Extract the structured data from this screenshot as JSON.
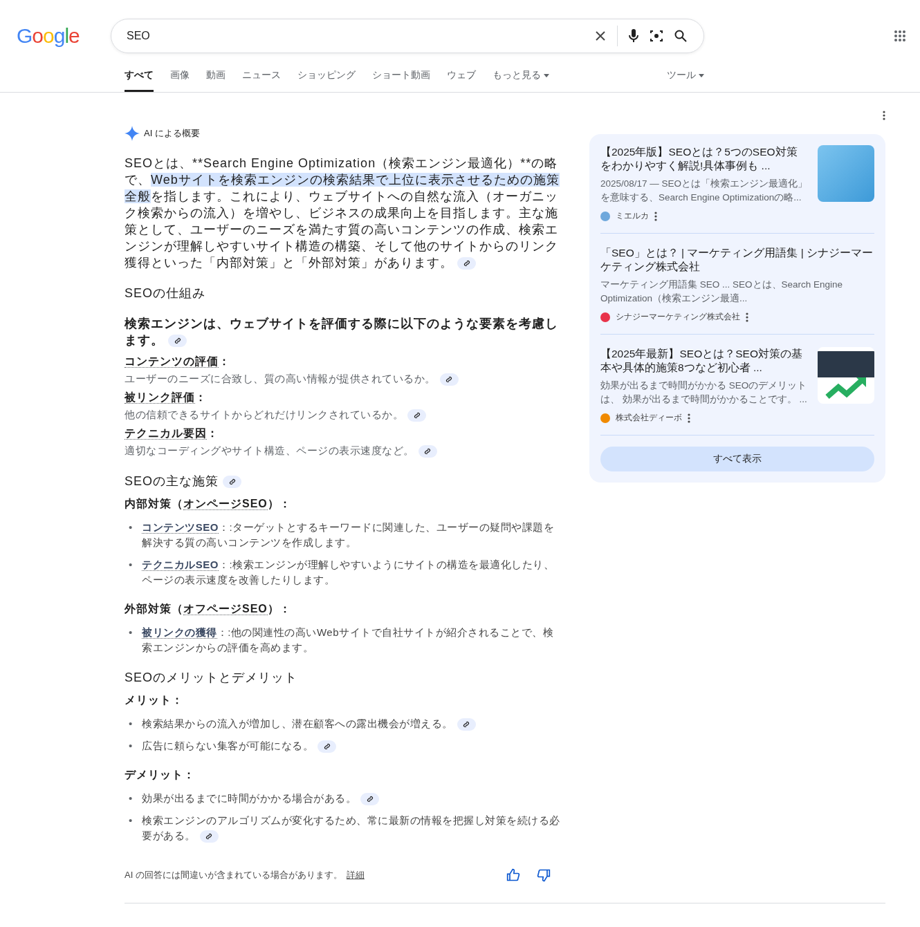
{
  "header": {
    "logo": "Google",
    "query": "SEO"
  },
  "tabs": [
    {
      "label": "すべて",
      "selected": true,
      "menu": false
    },
    {
      "label": "画像",
      "selected": false,
      "menu": false
    },
    {
      "label": "動画",
      "selected": false,
      "menu": false
    },
    {
      "label": "ニュース",
      "selected": false,
      "menu": false
    },
    {
      "label": "ショッピング",
      "selected": false,
      "menu": false
    },
    {
      "label": "ショート動画",
      "selected": false,
      "menu": false
    },
    {
      "label": "ウェブ",
      "selected": false,
      "menu": false
    },
    {
      "label": "もっと見る",
      "selected": false,
      "menu": true
    }
  ],
  "tools": "ツール",
  "overview": {
    "title": "AI による概要",
    "intro": [
      {
        "text": "SEOとは、**Search Engine Optimization（検索エンジン最適化）**の略で、",
        "highlighted": false
      },
      {
        "text": "Webサイトを検索エンジンの検索結果で上位に表示させるための施策全般",
        "highlighted": true
      },
      {
        "text": "を指します。これにより、ウェブサイトへの自然な流入（オーガニック検索からの流入）を増やし、ビジネスの成果向上を目指します。主な施策として、ユーザーのニーズを満たす質の高いコンテンツの作成、検索エンジンが理解しやすいサイト構造の構築、そして他のサイトからのリンク獲得といった「内部対策」と「外部対策」があります。",
        "highlighted": false
      }
    ],
    "intro_cited": true,
    "blocks": [
      {
        "kind": "heading",
        "text": "SEOの仕組み",
        "cited": false
      },
      {
        "kind": "lead",
        "text": "検索エンジンは、ウェブサイトを評価する際に以下のような要素を考慮します。",
        "cited": true
      },
      {
        "kind": "term",
        "term": "コンテンツの評価",
        "suffix": "：",
        "cited": false
      },
      {
        "kind": "desc",
        "text": "ユーザーのニーズに合致し、質の高い情報が提供されているか。",
        "cited": true
      },
      {
        "kind": "term",
        "term": "被リンク評価",
        "suffix": "：",
        "cited": false
      },
      {
        "kind": "desc",
        "text": "他の信頼できるサイトからどれだけリンクされているか。",
        "cited": true
      },
      {
        "kind": "term",
        "term": "テクニカル要因",
        "suffix": "：",
        "cited": false
      },
      {
        "kind": "desc",
        "text": "適切なコーディングやサイト構造、ページの表示速度など。",
        "cited": true
      },
      {
        "kind": "heading",
        "text": "SEOの主な施策",
        "cited": true
      },
      {
        "kind": "term",
        "prefix": "内部対策（",
        "term": "オンページSEO",
        "suffix": "）：",
        "cited": false
      },
      {
        "kind": "bullets",
        "items": [
          {
            "bullet": "•",
            "term": "コンテンツSEO",
            "text": "：:ターゲットとするキーワードに関連した、ユーザーの疑問や課題を解決する質の高いコンテンツを作成します。",
            "cited": false
          },
          {
            "bullet": "•",
            "term": "テクニカルSEO",
            "text": "：:検索エンジンが理解しやすいようにサイトの構造を最適化したり、ページの表示速度を改善したりします。",
            "cited": false
          }
        ]
      },
      {
        "kind": "term",
        "prefix": "外部対策（",
        "term": "オフページSEO",
        "suffix": "）：",
        "cited": false
      },
      {
        "kind": "bullets",
        "items": [
          {
            "bullet": "•",
            "term": "被リンクの獲得",
            "text": "：:他の関連性の高いWebサイトで自社サイトが紹介されることで、検索エンジンからの評価を高めます。",
            "cited": false
          }
        ]
      },
      {
        "kind": "heading",
        "text": "SEOのメリットとデメリット",
        "cited": false
      },
      {
        "kind": "label",
        "text": "メリット：",
        "cited": false
      },
      {
        "kind": "bullets",
        "items": [
          {
            "bullet": "•",
            "text": "検索結果からの流入が増加し、潜在顧客への露出機会が増える。",
            "cited": true
          },
          {
            "bullet": "•",
            "text": "広告に頼らない集客が可能になる。",
            "cited": true
          }
        ]
      },
      {
        "kind": "label",
        "text": "デメリット：",
        "cited": false
      },
      {
        "kind": "bullets",
        "items": [
          {
            "bullet": "•",
            "text": "効果が出るまでに時間がかかる場合がある。",
            "cited": true
          },
          {
            "bullet": "•",
            "text": "検索エンジンのアルゴリズムが変化するため、常に最新の情報を把握し対策を続ける必要がある。",
            "cited": true
          }
        ]
      }
    ],
    "disclaimer": "AI の回答には間違いが含まれている場合があります。",
    "details_link": "詳細"
  },
  "sources": {
    "cards": [
      {
        "title": "【2025年版】SEOとは？5つのSEO対策をわかりやすく解説!具体事例も ...",
        "snippet": "2025/08/17 — SEOとは「検索エンジン最適化」を意味する、Search Engine Optimizationの略...",
        "source": "ミエルカ",
        "color": "#6fa8dc",
        "kind": "banner"
      },
      {
        "title": "「SEO」とは？ | マーケティング用語集 | シナジーマーケティング株式会社",
        "snippet": "マーケティング用語集 SEO ... SEOとは、Search Engine Optimization（検索エンジン最適...",
        "source": "シナジーマーケティング株式会社",
        "color": "#e8334a",
        "kind": "plain"
      },
      {
        "title": "【2025年最新】SEOとは？SEO対策の基本や具体的施策8つなど初心者 ...",
        "snippet": "効果が出るまで時間がかかる SEOのデメリットは、 効果が出るまで時間がかかることです。 ...",
        "source": "株式会社ディーボ",
        "color": "#f08a00",
        "kind": "logo"
      }
    ],
    "show_all": "すべて表示"
  }
}
